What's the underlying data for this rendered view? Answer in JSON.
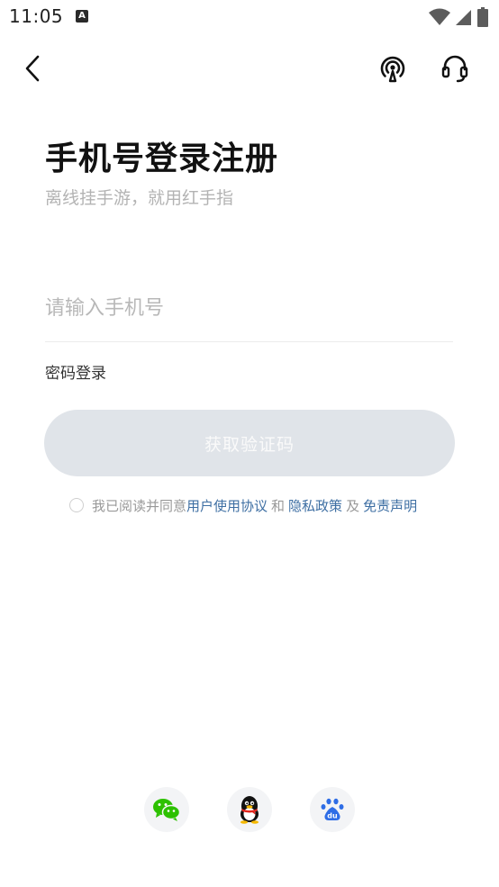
{
  "status_bar": {
    "time": "11:05",
    "a_glyph": "A",
    "icons": [
      "a-notification-icon",
      "wifi-icon",
      "signal-icon",
      "battery-icon"
    ]
  },
  "header": {
    "back_icon": "chevron-left-icon",
    "broadcast_icon": "broadcast-icon",
    "support_icon": "headset-icon"
  },
  "login": {
    "title": "手机号登录注册",
    "subtitle": "离线挂手游，就用红手指",
    "phone_placeholder": "请输入手机号",
    "password_login": "密码登录",
    "get_code_button": "获取验证码"
  },
  "agreement": {
    "prefix": "我已阅读并同意",
    "user_agreement": "用户使用协议",
    "and": "和",
    "privacy_policy": "隐私政策",
    "also": "及",
    "disclaimer": "免责声明"
  },
  "social_login": [
    {
      "name": "wechat",
      "icon": "wechat-icon",
      "color": "#2dc100"
    },
    {
      "name": "qq",
      "icon": "qq-penguin-icon",
      "color": "#111111"
    },
    {
      "name": "baidu",
      "icon": "baidu-paw-icon",
      "color": "#2e6de6"
    }
  ],
  "colors": {
    "link": "#3e6fa3",
    "button_disabled_bg": "#e0e4e9",
    "placeholder": "#b8b8b8"
  }
}
